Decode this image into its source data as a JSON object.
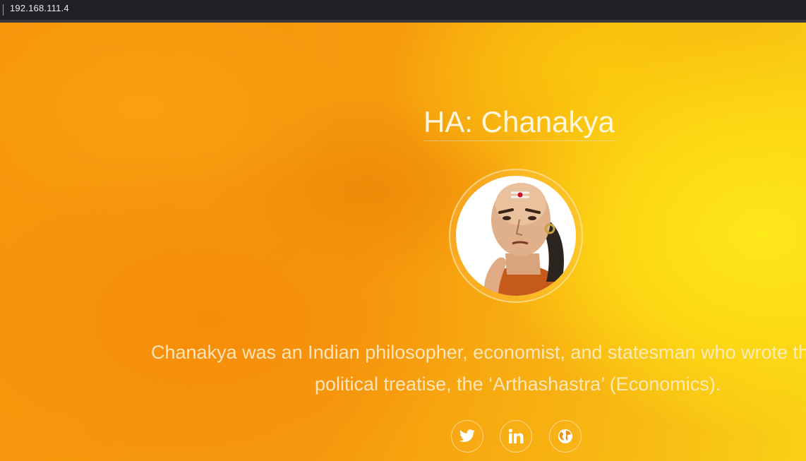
{
  "browser": {
    "url": "192.168.111.4"
  },
  "profile": {
    "title": "HA: Chanakya",
    "bio_line1": "Chanakya was an Indian philosopher, economist, and statesman who wrote th",
    "bio_line2": "political treatise, the ‘Arthashastra’ (Economics)."
  },
  "social": [
    {
      "icon": "twitter-icon"
    },
    {
      "icon": "linkedin-icon"
    },
    {
      "icon": "globe-icon"
    }
  ],
  "colors": {
    "accent": "#f59a0c",
    "text": "#fff6e0"
  }
}
